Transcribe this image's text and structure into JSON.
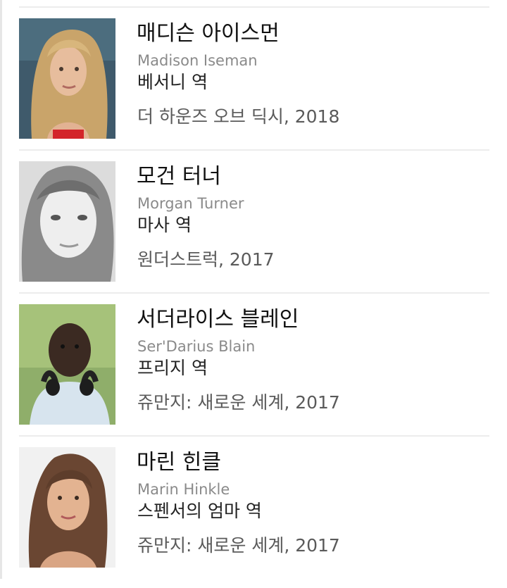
{
  "cast": [
    {
      "name_ko": "매디슨 아이스먼",
      "name_en": "Madison Iseman",
      "role": "베서니 역",
      "work": "더 하운즈 오브 딕시, 2018"
    },
    {
      "name_ko": "모건 터너",
      "name_en": "Morgan Turner",
      "role": "마사 역",
      "work": "원더스트럭, 2017"
    },
    {
      "name_ko": "서더라이스 블레인",
      "name_en": "Ser'Darius Blain",
      "role": "프리지 역",
      "work": "쥬만지: 새로운 세계, 2017"
    },
    {
      "name_ko": "마린 힌클",
      "name_en": "Marin Hinkle",
      "role": "스펜서의 엄마 역",
      "work": "쥬만지: 새로운 세계, 2017"
    }
  ]
}
